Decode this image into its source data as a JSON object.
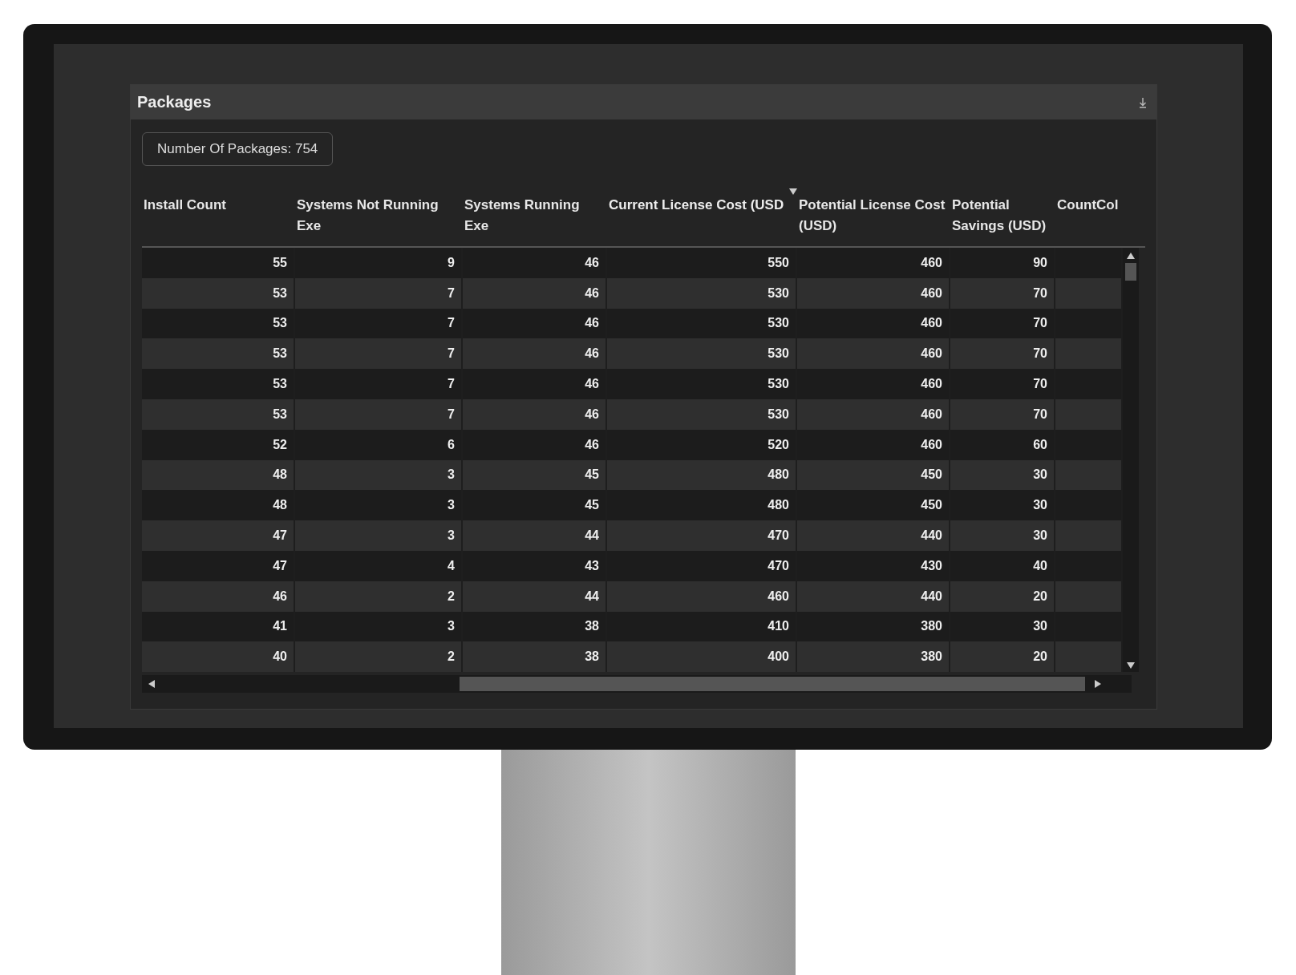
{
  "panel": {
    "title": "Packages",
    "count_badge": "Number Of Packages: 754"
  },
  "table": {
    "columns": [
      {
        "label": "Install Count",
        "sorted": false
      },
      {
        "label": "Systems Not Running Exe",
        "sorted": false
      },
      {
        "label": "Systems Running Exe",
        "sorted": false
      },
      {
        "label": "Current License Cost (USD",
        "sorted": true
      },
      {
        "label": "Potential License Cost (USD)",
        "sorted": false
      },
      {
        "label": "Potential Savings (USD)",
        "sorted": false
      },
      {
        "label": "CountCol",
        "sorted": false
      }
    ],
    "rows": [
      [
        "55",
        "9",
        "46",
        "550",
        "460",
        "90"
      ],
      [
        "53",
        "7",
        "46",
        "530",
        "460",
        "70"
      ],
      [
        "53",
        "7",
        "46",
        "530",
        "460",
        "70"
      ],
      [
        "53",
        "7",
        "46",
        "530",
        "460",
        "70"
      ],
      [
        "53",
        "7",
        "46",
        "530",
        "460",
        "70"
      ],
      [
        "53",
        "7",
        "46",
        "530",
        "460",
        "70"
      ],
      [
        "52",
        "6",
        "46",
        "520",
        "460",
        "60"
      ],
      [
        "48",
        "3",
        "45",
        "480",
        "450",
        "30"
      ],
      [
        "48",
        "3",
        "45",
        "480",
        "450",
        "30"
      ],
      [
        "47",
        "3",
        "44",
        "470",
        "440",
        "30"
      ],
      [
        "47",
        "4",
        "43",
        "470",
        "430",
        "40"
      ],
      [
        "46",
        "2",
        "44",
        "460",
        "440",
        "20"
      ],
      [
        "41",
        "3",
        "38",
        "410",
        "380",
        "30"
      ],
      [
        "40",
        "2",
        "38",
        "400",
        "380",
        "20"
      ]
    ]
  }
}
